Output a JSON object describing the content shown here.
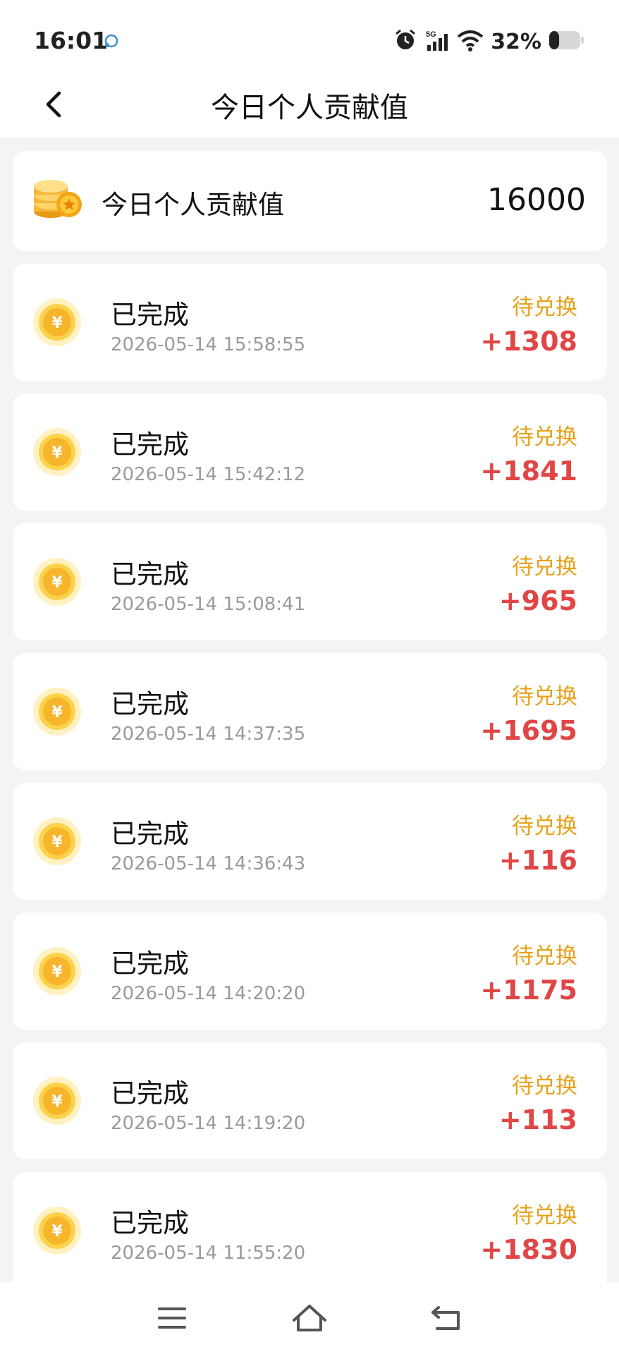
{
  "status_bar": {
    "time": "16:01",
    "network": "5G",
    "battery": "32%",
    "battery_level": 0.32
  },
  "header": {
    "title": "今日个人贡献值",
    "back_icon": "back-arrow-icon"
  },
  "summary": {
    "label": "今日个人贡献值",
    "value": "16000",
    "icon": "coin-stack-icon"
  },
  "records": [
    {
      "title": "已完成",
      "time": "2026-05-14 15:58:55",
      "status": "待兑换",
      "amount": "+1308"
    },
    {
      "title": "已完成",
      "time": "2026-05-14 15:42:12",
      "status": "待兑换",
      "amount": "+1841"
    },
    {
      "title": "已完成",
      "time": "2026-05-14 15:08:41",
      "status": "待兑换",
      "amount": "+965"
    },
    {
      "title": "已完成",
      "time": "2026-05-14 14:37:35",
      "status": "待兑换",
      "amount": "+1695"
    },
    {
      "title": "已完成",
      "time": "2026-05-14 14:36:43",
      "status": "待兑换",
      "amount": "+116"
    },
    {
      "title": "已完成",
      "time": "2026-05-14 14:20:20",
      "status": "待兑换",
      "amount": "+1175"
    },
    {
      "title": "已完成",
      "time": "2026-05-14 14:19:20",
      "status": "待兑换",
      "amount": "+113"
    },
    {
      "title": "已完成",
      "time": "2026-05-14 11:55:20",
      "status": "待兑换",
      "amount": "+1830"
    }
  ],
  "colors": {
    "status_pending": "#e8a21a",
    "amount": "#e14646",
    "coin": "#f7b52c"
  },
  "bottom_nav": [
    "menu-icon",
    "home-icon",
    "back-icon"
  ]
}
